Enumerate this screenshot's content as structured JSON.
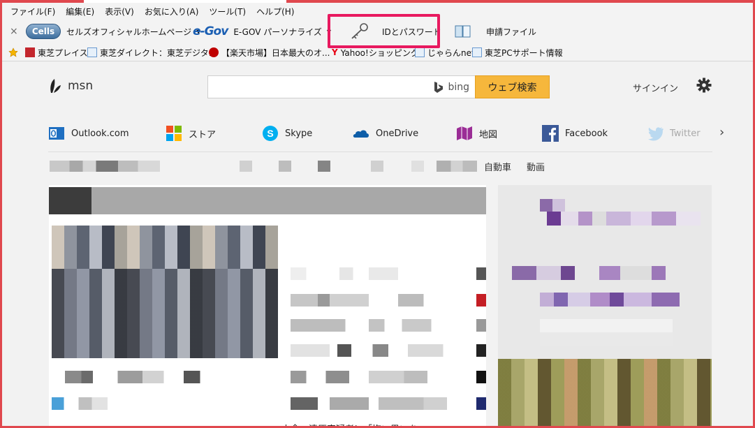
{
  "menu": [
    "ファイル(F)",
    "編集(E)",
    "表示(V)",
    "お気に入り(A)",
    "ツール(T)",
    "ヘルプ(H)"
  ],
  "toolbar": {
    "close": "×",
    "cells_logo": "Cells",
    "cells_label": "セルズオフィシャルホームページ",
    "egov_logo": "e-Gov",
    "egov_label": "E-GOV パーソナライズ",
    "id_password": "IDとパスワード",
    "application_file": "申請ファイル"
  },
  "favorites": [
    {
      "label": "東芝プレイス"
    },
    {
      "label": "東芝ダイレクト：東芝デジタ..."
    },
    {
      "label": "【楽天市場】日本最大のオ..."
    },
    {
      "label": "Yahoo!ショッピング"
    },
    {
      "label": "じゃらんnet"
    },
    {
      "label": "東芝PCサポート情報"
    }
  ],
  "msn": {
    "logo": "msn",
    "search_placeholder": "",
    "bing": "bing",
    "search_button": "ウェブ検索",
    "signin": "サインイン"
  },
  "nav": [
    {
      "label": "Outlook.com",
      "icon": "outlook-icon"
    },
    {
      "label": "ストア",
      "icon": "windows-store-icon"
    },
    {
      "label": "Skype",
      "icon": "skype-icon"
    },
    {
      "label": "OneDrive",
      "icon": "onedrive-icon"
    },
    {
      "label": "地図",
      "icon": "maps-icon"
    },
    {
      "label": "Facebook",
      "icon": "facebook-icon"
    },
    {
      "label": "Twitter",
      "icon": "twitter-icon"
    }
  ],
  "categories": [
    "自動車",
    "動画"
  ],
  "headline": "山舎、清原容疑者に「悔い思いを",
  "colors": {
    "frame": "#e0484e",
    "highlight": "#e8195f",
    "search_button": "#f6b73c"
  }
}
